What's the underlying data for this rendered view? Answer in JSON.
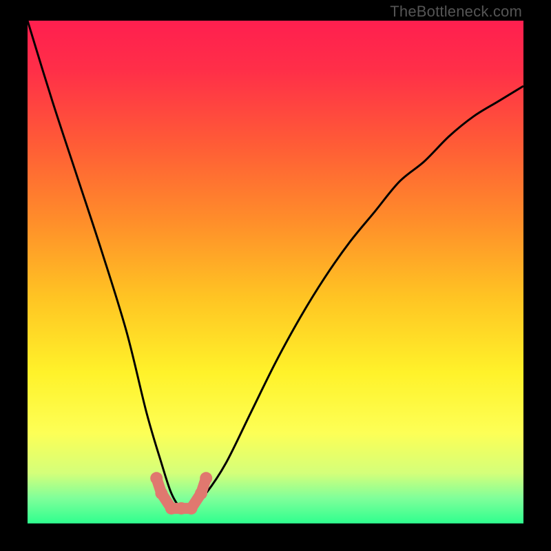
{
  "watermark": {
    "text": "TheBottleneck.com"
  },
  "chart_data": {
    "type": "line",
    "title": "",
    "xlabel": "",
    "ylabel": "",
    "xlim": [
      0,
      100
    ],
    "ylim": [
      0,
      100
    ],
    "grid": false,
    "legend": false,
    "series": [
      {
        "name": "bottleneck-curve",
        "x": [
          0,
          5,
          10,
          15,
          20,
          24,
          27,
          29,
          31,
          33,
          36,
          40,
          45,
          50,
          55,
          60,
          65,
          70,
          75,
          80,
          85,
          90,
          95,
          100
        ],
        "values": [
          100,
          84,
          69,
          54,
          38,
          22,
          12,
          6,
          3,
          3,
          6,
          12,
          22,
          32,
          41,
          49,
          56,
          62,
          68,
          72,
          77,
          81,
          84,
          87
        ]
      },
      {
        "name": "highlight-markers",
        "x": [
          26,
          27,
          29,
          31,
          33,
          35,
          36
        ],
        "values": [
          9,
          6,
          3,
          3,
          3,
          6,
          9
        ]
      }
    ],
    "background_gradient": {
      "stops": [
        {
          "offset": 0.0,
          "color": "#ff1f4f"
        },
        {
          "offset": 0.1,
          "color": "#ff2f48"
        },
        {
          "offset": 0.25,
          "color": "#ff5d36"
        },
        {
          "offset": 0.4,
          "color": "#ff8e2a"
        },
        {
          "offset": 0.55,
          "color": "#ffc423"
        },
        {
          "offset": 0.7,
          "color": "#fff22a"
        },
        {
          "offset": 0.82,
          "color": "#fdff56"
        },
        {
          "offset": 0.9,
          "color": "#d4ff7a"
        },
        {
          "offset": 0.95,
          "color": "#7fff9a"
        },
        {
          "offset": 1.0,
          "color": "#2fff8e"
        }
      ]
    },
    "marker_color": "#e0786f",
    "curve_color": "#000000",
    "curve_width": 3
  }
}
